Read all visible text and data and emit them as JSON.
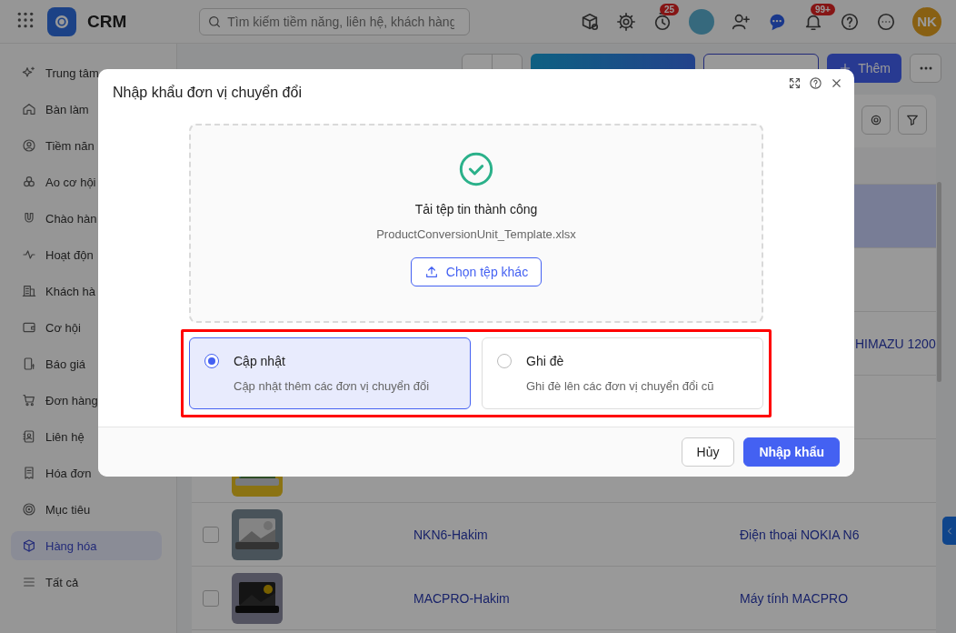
{
  "topbar": {
    "app_name": "CRM",
    "search": {
      "placeholder": "Tìm kiếm tiềm năng, liên hệ, khách hàng"
    },
    "timer_badge": "25",
    "notification_badge": "99+",
    "avatar": "NK"
  },
  "sidebar": {
    "items": [
      {
        "label": "Trung tâm",
        "selected": false
      },
      {
        "label": "Bàn làm",
        "selected": false
      },
      {
        "label": "Tiềm năn",
        "selected": false
      },
      {
        "label": "Ao cơ hội",
        "selected": false
      },
      {
        "label": "Chào hàn",
        "selected": false
      },
      {
        "label": "Hoạt độn",
        "selected": false
      },
      {
        "label": "Khách hà",
        "selected": false
      },
      {
        "label": "Cơ hội",
        "selected": false
      },
      {
        "label": "Báo giá",
        "selected": false
      },
      {
        "label": "Đơn hàng",
        "selected": false
      },
      {
        "label": "Liên hệ",
        "selected": false
      },
      {
        "label": "Hóa đơn",
        "selected": false
      },
      {
        "label": "Mục tiêu",
        "selected": false
      },
      {
        "label": "Hàng hóa",
        "selected": true
      },
      {
        "label": "Tất cả",
        "selected": false
      }
    ]
  },
  "page": {
    "add_button": "Thêm"
  },
  "table": {
    "rows": [
      {
        "selected": true
      },
      {
        "selected": false
      },
      {
        "selected": false,
        "name": "HIMAZU 1200"
      },
      {
        "selected": false
      },
      {
        "selected": false,
        "kind": "picture"
      },
      {
        "selected": false,
        "checked": false,
        "kind": "picture",
        "code": "NKN6-Hakim",
        "name": "Điện thoại NOKIA N6"
      },
      {
        "selected": false,
        "checked": false,
        "kind": "picture",
        "code": "MACPRO-Hakim",
        "name": "Máy tính MACPRO"
      }
    ]
  },
  "modal": {
    "title": "Nhập khẩu đơn vị chuyển đổi",
    "upload_status": "Tải tệp tin thành công",
    "file_name": "ProductConversionUnit_Template.xlsx",
    "choose_button": "Chọn tệp khác",
    "options": [
      {
        "label": "Cập nhật",
        "description": "Cập nhật thêm các đơn vị chuyển đổi",
        "selected": true
      },
      {
        "label": "Ghi đè",
        "description": "Ghi đè lên các đơn vị chuyển đổi cũ",
        "selected": false
      }
    ],
    "buttons": [
      {
        "label": "Hủy",
        "kind": "secondary"
      },
      {
        "label": "Nhập khẩu",
        "kind": "primary"
      }
    ]
  }
}
